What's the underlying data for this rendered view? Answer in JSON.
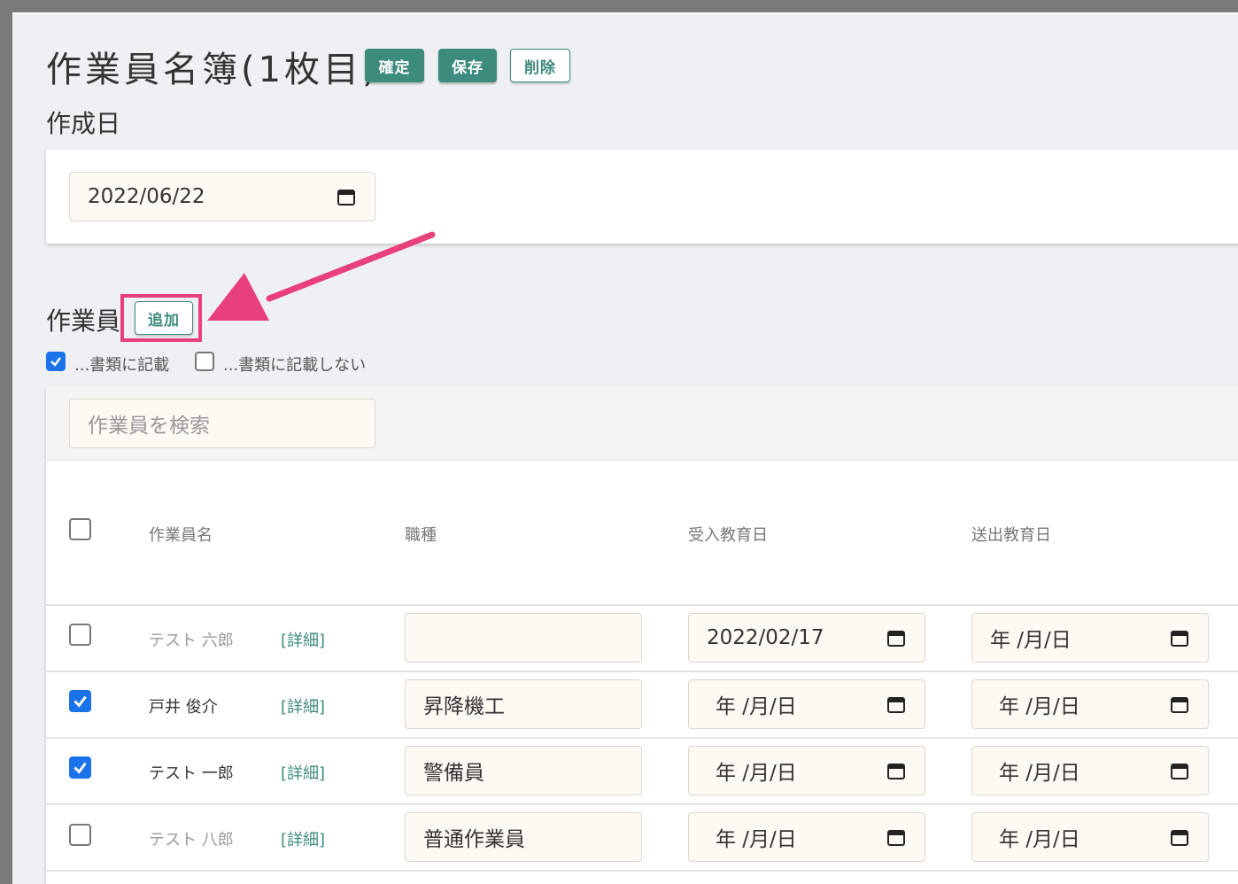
{
  "header": {
    "title": "作業員名簿(1枚目)",
    "confirm_label": "確定",
    "save_label": "保存",
    "delete_label": "削除"
  },
  "created": {
    "label": "作成日",
    "date_value": "2022/06/22"
  },
  "workers": {
    "label": "作業員",
    "add_label": "追加",
    "filter_include_label": "...書類に記載",
    "filter_include_checked": true,
    "filter_exclude_label": "...書類に記載しない",
    "filter_exclude_checked": false,
    "search_placeholder": "作業員を検索",
    "columns": {
      "name": "作業員名",
      "job": "職種",
      "intake": "受入教育日",
      "sendout": "送出教育日"
    },
    "detail_label": "[詳細]",
    "date_placeholder": "年 /月/日",
    "rows": [
      {
        "checked": false,
        "name": "テスト 六郎",
        "job": "",
        "intake": "2022/02/17",
        "sendout": "年 /月/日"
      },
      {
        "checked": true,
        "name": "戸井 俊介",
        "job": "昇降機工",
        "intake": "年 /月/日",
        "sendout": "年 /月/日"
      },
      {
        "checked": true,
        "name": "テスト 一郎",
        "job": "警備員",
        "intake": "年 /月/日",
        "sendout": "年 /月/日"
      },
      {
        "checked": false,
        "name": "テスト 八郎",
        "job": "普通作業員",
        "intake": "年 /月/日",
        "sendout": "年 /月/日"
      }
    ]
  },
  "colors": {
    "accent": "#3d8b7d",
    "highlight": "#e8407a",
    "checkbox": "#1a73e8",
    "field_bg": "#fdf9f3"
  }
}
